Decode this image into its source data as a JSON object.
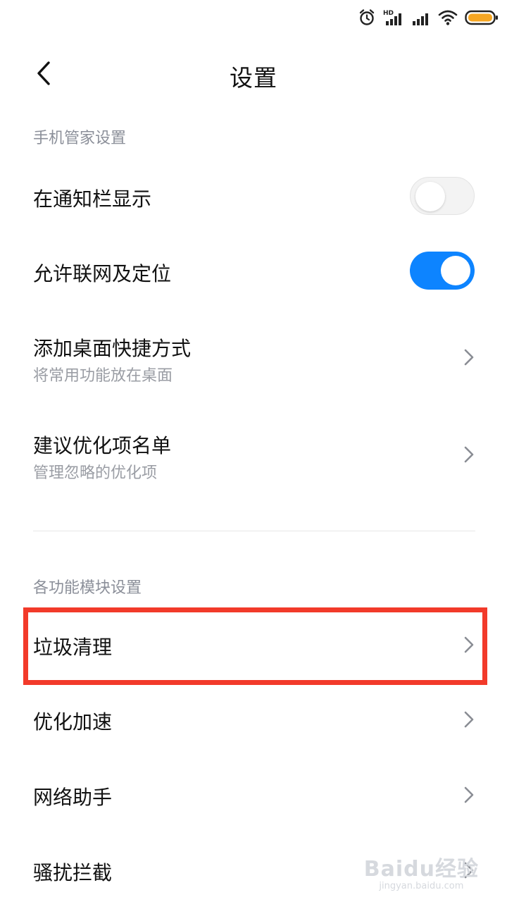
{
  "status_bar": {
    "icons": [
      "alarm-icon",
      "hd-signal-icon",
      "signal-icon",
      "wifi-icon",
      "battery-icon"
    ],
    "hd_label": "HD",
    "battery_color": "#f5a623"
  },
  "header": {
    "title": "设置",
    "back_icon": "chevron-left-icon"
  },
  "sections": {
    "manager": {
      "title": "手机管家设置"
    },
    "modules": {
      "title": "各功能模块设置"
    }
  },
  "settings": {
    "notify_bar": {
      "title": "在通知栏显示",
      "enabled": false
    },
    "network_location": {
      "title": "允许联网及定位",
      "enabled": true
    },
    "desktop_shortcut": {
      "title": "添加桌面快捷方式",
      "subtitle": "将常用功能放在桌面"
    },
    "optimize_list": {
      "title": "建议优化项名单",
      "subtitle": "管理忽略的优化项"
    }
  },
  "modules": {
    "cleanup": {
      "title": "垃圾清理"
    },
    "speedup": {
      "title": "优化加速"
    },
    "network": {
      "title": "网络助手"
    },
    "harassment": {
      "title": "骚扰拦截"
    }
  },
  "colors": {
    "accent": "#0d84ff",
    "highlight": "#f23a2a",
    "section_text": "#8b8f99"
  },
  "watermark": {
    "main": "Baidu经验",
    "sub": "jingyan.baidu.com"
  }
}
